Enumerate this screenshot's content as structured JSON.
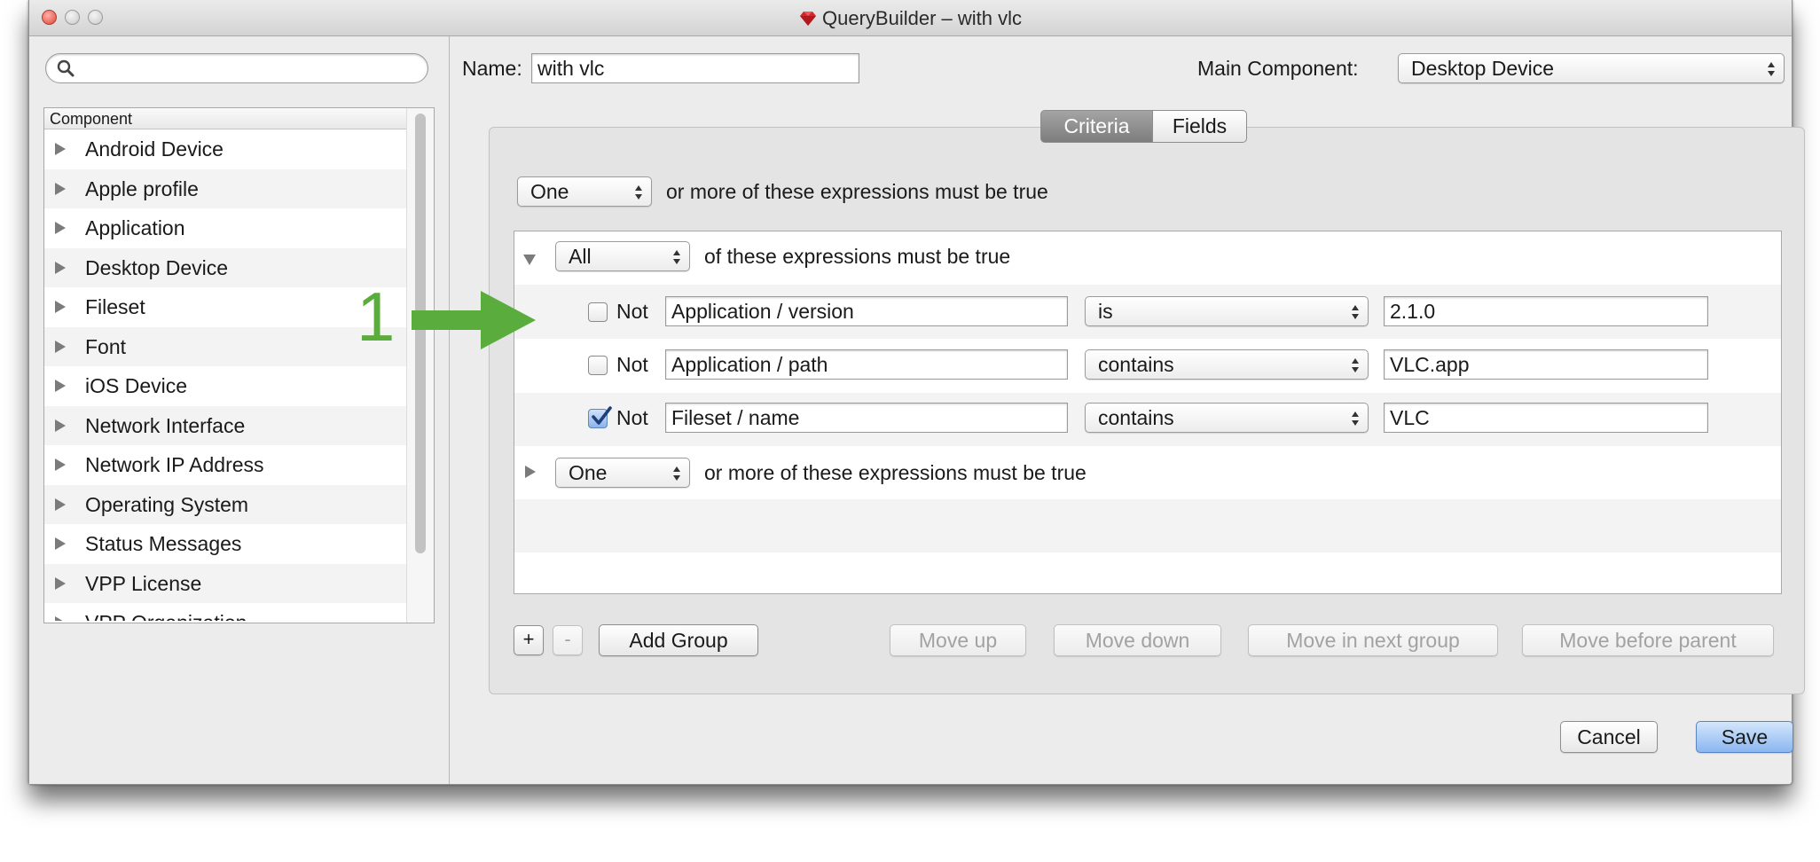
{
  "window": {
    "title": "QueryBuilder – with vlc",
    "app_icon": "red-gem-icon"
  },
  "sidebar": {
    "search": {
      "placeholder": "",
      "value": ""
    },
    "tree_header": "Component",
    "items": [
      {
        "label": "Android Device"
      },
      {
        "label": "Apple profile"
      },
      {
        "label": "Application"
      },
      {
        "label": "Desktop Device"
      },
      {
        "label": "Fileset"
      },
      {
        "label": "Font"
      },
      {
        "label": "iOS Device"
      },
      {
        "label": "Network Interface"
      },
      {
        "label": "Network IP Address"
      },
      {
        "label": "Operating System"
      },
      {
        "label": "Status Messages"
      },
      {
        "label": "VPP License"
      },
      {
        "label": "VPP Organization"
      }
    ]
  },
  "main": {
    "name_label": "Name:",
    "name_value": "with vlc",
    "main_component_label": "Main Component:",
    "main_component_value": "Desktop Device",
    "tabs": [
      {
        "label": "Criteria",
        "selected": true
      },
      {
        "label": "Fields",
        "selected": false
      }
    ],
    "top_quantifier": {
      "value": "One",
      "text": "or more of these expressions must be true"
    },
    "group": {
      "quantifier": "All",
      "text": "of these expressions must be true",
      "rows": [
        {
          "not_label": "Not",
          "checked": false,
          "field": "Application / version",
          "operator": "is",
          "value": "2.1.0"
        },
        {
          "not_label": "Not",
          "checked": false,
          "field": "Application / path",
          "operator": "contains",
          "value": "VLC.app"
        },
        {
          "not_label": "Not",
          "checked": true,
          "field": "Fileset / name",
          "operator": "contains",
          "value": "VLC"
        }
      ]
    },
    "subgroup": {
      "quantifier": "One",
      "text": "or more of these expressions must be true"
    },
    "buttons": {
      "add": "+",
      "remove": "-",
      "add_group": "Add Group",
      "move_up": "Move up",
      "move_down": "Move down",
      "move_next_group": "Move in next group",
      "move_before_parent": "Move before parent",
      "cancel": "Cancel",
      "save": "Save"
    }
  },
  "annotation": {
    "number": "1",
    "color": "#5aad3c"
  },
  "colors": {
    "accent": "#8ab7f0",
    "selected_tab": "#8a8a8a",
    "annotation_green": "#5aad3c"
  }
}
